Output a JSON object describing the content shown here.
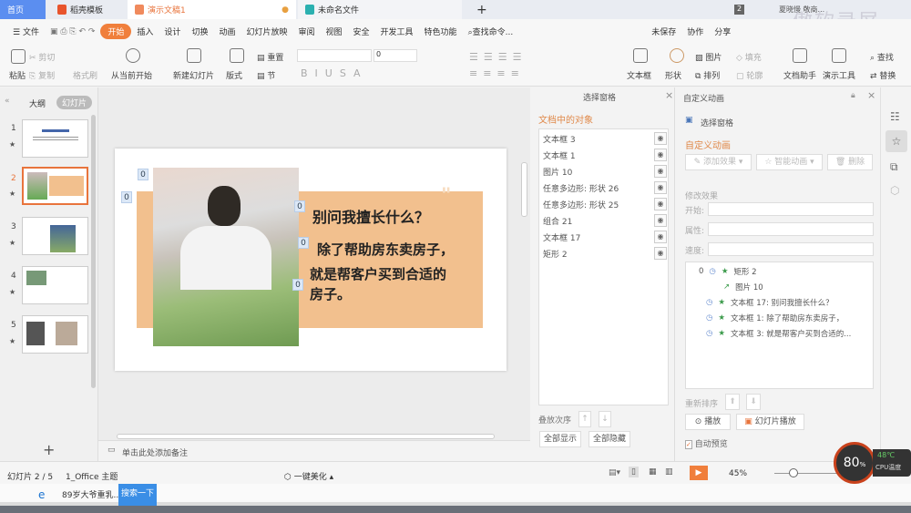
{
  "tabs": [
    {
      "label": "首页"
    },
    {
      "label": "稻壳模板"
    },
    {
      "label": "演示文稿1"
    },
    {
      "label": "未命名文件"
    }
  ],
  "tabbar": {
    "add": "+",
    "count": "2",
    "user": "夏晓慢 敬商...",
    "watermark": "傲软录屏"
  },
  "menu": {
    "file": "文件",
    "items": [
      "开始",
      "插入",
      "设计",
      "切换",
      "动画",
      "幻灯片放映",
      "审阅",
      "视图",
      "安全",
      "开发工具",
      "特色功能"
    ],
    "search": "查找命令...",
    "unsaved": "未保存",
    "collab": "协作",
    "share": "分享"
  },
  "ribbon": {
    "paste": "粘贴",
    "cut": "剪切",
    "copy": "复制",
    "format_painter": "格式刷",
    "play_from_current": "从当前开始",
    "new_slide": "新建幻灯片",
    "layout": "版式",
    "reset": "重置",
    "section": "节",
    "font_size": "0",
    "textbox": "文本框",
    "shape": "形状",
    "picture": "图片",
    "arrange": "排列",
    "fill": "填充",
    "outline": "轮廓",
    "doc_helper": "文档助手",
    "present_tools": "演示工具",
    "find": "查找",
    "replace": "替换"
  },
  "leftpanel": {
    "outline_tab": "大纲",
    "slides_tab": "幻灯片",
    "slides": [
      "1",
      "2",
      "3",
      "4",
      "5"
    ],
    "add": "+"
  },
  "slide": {
    "title": "别问我擅长什么？",
    "line1": "除了帮助房东卖房子，",
    "line2": "就是帮客户买到合适的",
    "line3": "房子。",
    "badges": [
      "0",
      "0",
      "0",
      "0",
      "0"
    ],
    "accent": "#f2c08e"
  },
  "notes": "单击此处添加备注",
  "selpane": {
    "title": "选择窗格",
    "heading": "文档中的对象",
    "objects": [
      "文本框 3",
      "文本框 1",
      "图片 10",
      "任意多边形: 形状 26",
      "任意多边形: 形状 25",
      "组合 21",
      "文本框 17",
      "矩形 2"
    ],
    "order_label": "叠放次序",
    "show_all": "全部显示",
    "hide_all": "全部隐藏"
  },
  "animpane": {
    "title": "自定义动画",
    "sel_link": "选择窗格",
    "heading": "自定义动画",
    "add_effect": "添加效果",
    "smart": "智能动画",
    "delete": "删除",
    "modify": "修改效果",
    "start": "开始:",
    "property": "属性:",
    "speed": "速度:",
    "items": [
      {
        "num": "0",
        "label": "矩形 2"
      },
      {
        "num": "",
        "label": "图片 10"
      },
      {
        "num": "",
        "label": "文本框 17: 别问我擅长什么？"
      },
      {
        "num": "",
        "label": "文本框 1: 除了帮助房东卖房子，"
      },
      {
        "num": "",
        "label": "文本框 3: 就是帮客户买到合适的..."
      }
    ],
    "reorder": "重新排序",
    "play": "播放",
    "slideshow": "幻灯片播放",
    "autopreview": "自动预览"
  },
  "status": {
    "slide": "幻灯片 2 / 5",
    "theme": "1_Office 主题",
    "beautify": "一键美化",
    "zoom": "45%",
    "cpu": "80",
    "cpu_unit": "%",
    "temp": "48℃",
    "cpu_label": "CPU温度"
  },
  "taskbar": {
    "news": "89岁大爷重乳...",
    "search": "搜索一下"
  }
}
